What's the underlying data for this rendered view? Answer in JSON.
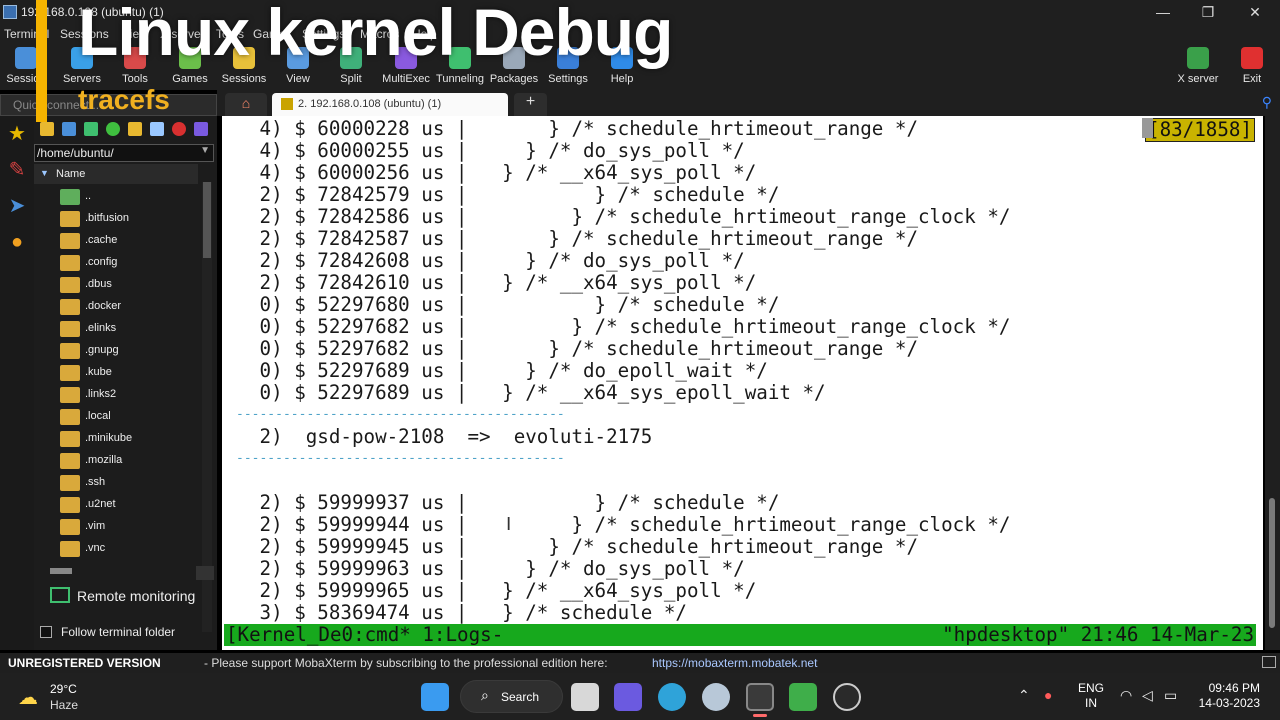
{
  "window": {
    "title": "192.168.0.108 (ubuntu) (1)",
    "controls": [
      "—",
      "❐",
      "✕"
    ]
  },
  "overlay": {
    "title": "Linux kernel Debug",
    "subtitle": "tracefs",
    "accent": "#f6b400"
  },
  "menu": [
    "Terminal",
    "Sessions",
    "View",
    "X server",
    "Tools",
    "Games",
    "Settings",
    "Macros",
    "Help"
  ],
  "toolbar": [
    {
      "label": "Session",
      "color": "#4a8fd9",
      "icon": "session-icon"
    },
    {
      "label": "Servers",
      "color": "#3aa0e8",
      "icon": "servers-icon"
    },
    {
      "label": "Tools",
      "color": "#d94a4a",
      "icon": "tools-icon"
    },
    {
      "label": "Games",
      "color": "#6bbf4a",
      "icon": "games-icon"
    },
    {
      "label": "Sessions",
      "color": "#e8c13a",
      "icon": "sessions-icon"
    },
    {
      "label": "View",
      "color": "#5a9be0",
      "icon": "view-icon"
    },
    {
      "label": "Split",
      "color": "#3fb07a",
      "icon": "split-icon"
    },
    {
      "label": "MultiExec",
      "color": "#8a5ae0",
      "icon": "multiexec-icon"
    },
    {
      "label": "Tunneling",
      "color": "#3fbf6f",
      "icon": "tunneling-icon"
    },
    {
      "label": "Packages",
      "color": "#9aa8b8",
      "icon": "packages-icon"
    },
    {
      "label": "Settings",
      "color": "#3a7fd9",
      "icon": "settings-icon"
    },
    {
      "label": "Help",
      "color": "#2f8be8",
      "icon": "help-icon"
    }
  ],
  "toolbar_right": [
    {
      "label": "X server",
      "color": "#3aa04a",
      "icon": "xserver-icon"
    },
    {
      "label": "Exit",
      "color": "#e03030",
      "icon": "exit-icon"
    }
  ],
  "quick_connect_placeholder": "Quick connect...",
  "file_browser": {
    "path": "/home/ubuntu/",
    "column": "Name",
    "items": [
      "..",
      ".bitfusion",
      ".cache",
      ".config",
      ".dbus",
      ".docker",
      ".elinks",
      ".gnupg",
      ".kube",
      ".links2",
      ".local",
      ".minikube",
      ".mozilla",
      ".ssh",
      ".u2net",
      ".vim",
      ".vnc"
    ],
    "remote_monitoring": "Remote monitoring",
    "follow_terminal_folder": "Follow terminal folder"
  },
  "tabs": {
    "active_label": "2. 192.168.0.108 (ubuntu) (1)",
    "new_tab": "+"
  },
  "terminal": {
    "line_counter": "[83/1858]",
    "lines": [
      " 4) $ 60000228 us |       } /* schedule_hrtimeout_range */",
      " 4) $ 60000255 us |     } /* do_sys_poll */",
      " 4) $ 60000256 us |   } /* __x64_sys_poll */",
      " 2) $ 72842579 us |           } /* schedule */",
      " 2) $ 72842586 us |         } /* schedule_hrtimeout_range_clock */",
      " 2) $ 72842587 us |       } /* schedule_hrtimeout_range */",
      " 2) $ 72842608 us |     } /* do_sys_poll */",
      " 2) $ 72842610 us |   } /* __x64_sys_poll */",
      " 0) $ 52297680 us |           } /* schedule */",
      " 0) $ 52297682 us |         } /* schedule_hrtimeout_range_clock */",
      " 0) $ 52297682 us |       } /* schedule_hrtimeout_range */",
      " 0) $ 52297689 us |     } /* do_epoll_wait */",
      " 0) $ 52297689 us |   } /* __x64_sys_epoll_wait */",
      "------------------------------------------",
      " 2)  gsd-pow-2108  =>  evoluti-2175",
      "------------------------------------------",
      "",
      " 2) $ 59999937 us |           } /* schedule */",
      " 2) $ 59999944 us |         } /* schedule_hrtimeout_range_clock */",
      " 2) $ 59999945 us |       } /* schedule_hrtimeout_range */",
      " 2) $ 59999963 us |     } /* do_sys_poll */",
      " 2) $ 59999965 us |   } /* __x64_sys_poll */",
      " 3) $ 58369474 us |   } /* schedule */"
    ],
    "status_left": "[Kernel_De0:cmd* 1:Logs-",
    "status_right": "\"hpdesktop\" 21:46 14-Mar-23"
  },
  "status_bar": {
    "unregistered": "UNREGISTERED VERSION",
    "message": "-  Please support MobaXterm by subscribing to the professional edition here:",
    "link": "https://mobaxterm.mobatek.net"
  },
  "taskbar": {
    "temperature": "29°C",
    "condition": "Haze",
    "search_label": "Search",
    "language_line1": "ENG",
    "language_line2": "IN",
    "time": "09:46 PM",
    "date": "14-03-2023"
  }
}
